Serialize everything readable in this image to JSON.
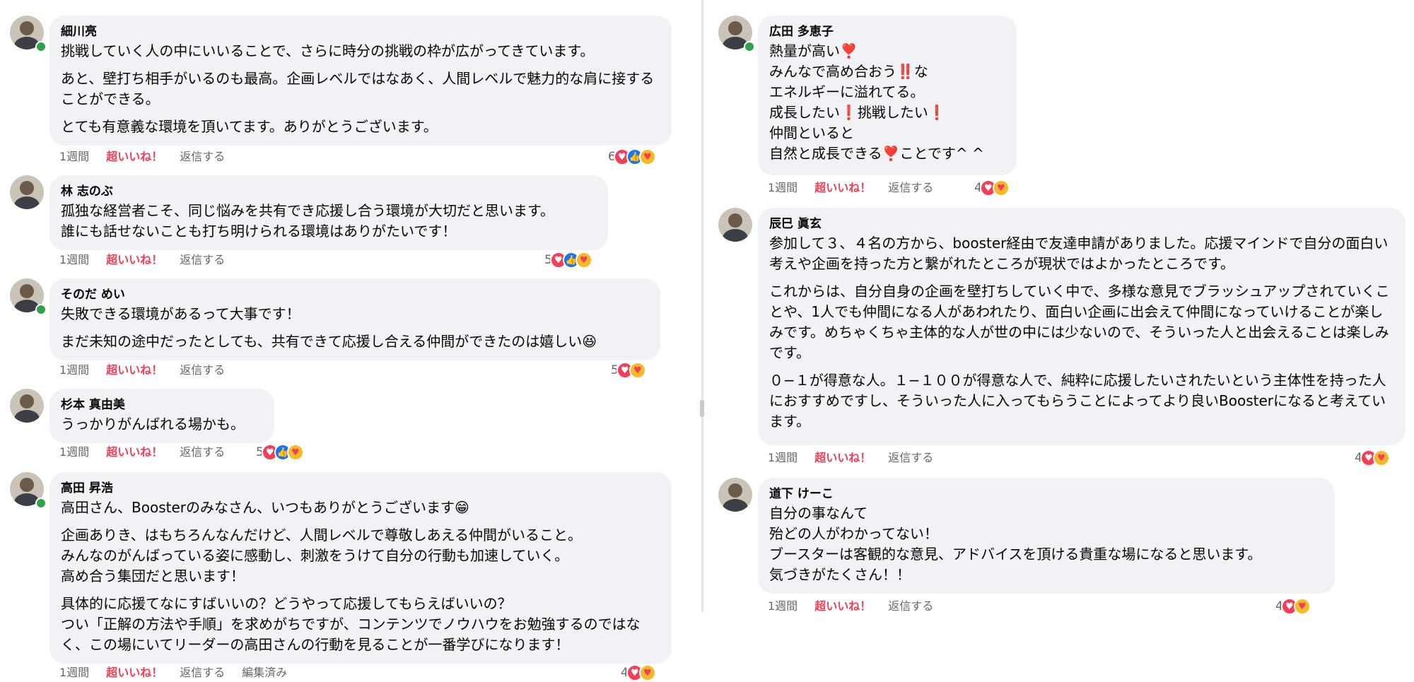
{
  "meta_labels": {
    "time": "1週間",
    "reaction": "超いいね！",
    "reply": "返信する",
    "edited": "編集済み"
  },
  "top_left_fragment": "…",
  "left": [
    {
      "author": "細川亮",
      "online": true,
      "paragraphs": [
        "挑戦していく人の中にいいることで、さらに時分の挑戦の枠が広がってきています。",
        "あと、壁打ち相手がいるのも最高。企画レベルではなあく、人間レベルで魅力的な肩に接することができる。",
        "とても有意義な環境を頂いてます。ありがとうございます。"
      ],
      "reaction_count": "6",
      "reactions": [
        "love",
        "like",
        "care"
      ]
    },
    {
      "author": "林 志のぶ",
      "online": false,
      "paragraphs": [
        "孤独な経営者こそ、同じ悩みを共有でき応援し合う環境が大切だと思います。\n誰にも話せないことも打ち明けられる環境はありがたいです！"
      ],
      "reaction_count": "5",
      "reactions": [
        "love",
        "like",
        "care"
      ]
    },
    {
      "author": "そのだ めい",
      "online": true,
      "paragraphs": [
        "失敗できる環境があるって大事です！",
        "まだ未知の途中だったとしても、共有できて応援し合える仲間ができたのは嬉しい😆"
      ],
      "reaction_count": "5",
      "reactions": [
        "love",
        "care"
      ]
    },
    {
      "author": "杉本 真由美",
      "online": false,
      "paragraphs": [
        "うっかりがんばれる場かも。"
      ],
      "reaction_count": "5",
      "reactions": [
        "love",
        "like",
        "care"
      ]
    },
    {
      "author": "高田 昇浩",
      "online": true,
      "paragraphs": [
        "高田さん、Boosterのみなさん、いつもありがとうございます😁",
        "企画ありき、はもちろんなんだけど、人間レベルで尊敬しあえる仲間がいること。\nみんなのがんばっている姿に感動し、刺激をうけて自分の行動も加速していく。\n高め合う集団だと思います！",
        "具体的に応援てなにすばいいの？どうやって応援してもらえばいいの？\nつい「正解の方法や手順」を求めがちですが、コンテンツでノウハウをお勉強するのではなく、この場にいてリーダーの高田さんの行動を見ることが一番学びになります！"
      ],
      "reaction_count": "4",
      "reactions": [
        "love",
        "care"
      ],
      "edited": true
    }
  ],
  "right": [
    {
      "author": "広田 多恵子",
      "online": true,
      "paragraphs": [
        "熱量が高い❣️\nみんなで高め合おう‼️な\nエネルギーに溢れてる。\n成長したい❗️挑戦したい❗️\n仲間といると\n自然と成長できる❣️ことです^ ^"
      ],
      "reaction_count": "4",
      "reactions": [
        "love",
        "care"
      ]
    },
    {
      "author": "辰巳 眞玄",
      "online": false,
      "paragraphs": [
        "参加して３、４名の方から、booster経由で友達申請がありました。応援マインドで自分の面白い考えや企画を持った方と繋がれたところが現状ではよかったところです。",
        "これからは、自分自身の企画を壁打ちしていく中で、多様な意見でブラッシュアップされていくことや、1人でも仲間になる人があわれたり、面白い企画に出会えて仲間になっていけることが楽しみです。めちゃくちゃ主体的な人が世の中には少ないので、そういった人と出会えることは楽しみです。",
        "０−１が得意な人。１−１００が得意な人で、純粋に応援したいされたいという主体性を持った人におすすめですし、そういった人に入ってもらうことによってより良いBoosterになると考えています。"
      ],
      "reaction_count": "4",
      "reactions": [
        "love",
        "care"
      ]
    },
    {
      "author": "道下 けーこ",
      "online": false,
      "paragraphs": [
        "自分の事なんて\n殆どの人がわかってない！\nブースターは客観的な意見、アドバイスを頂ける貴重な場になると思います。\n気づきがたくさん！！"
      ],
      "reaction_count": "4",
      "reactions": [
        "love",
        "care"
      ]
    }
  ]
}
